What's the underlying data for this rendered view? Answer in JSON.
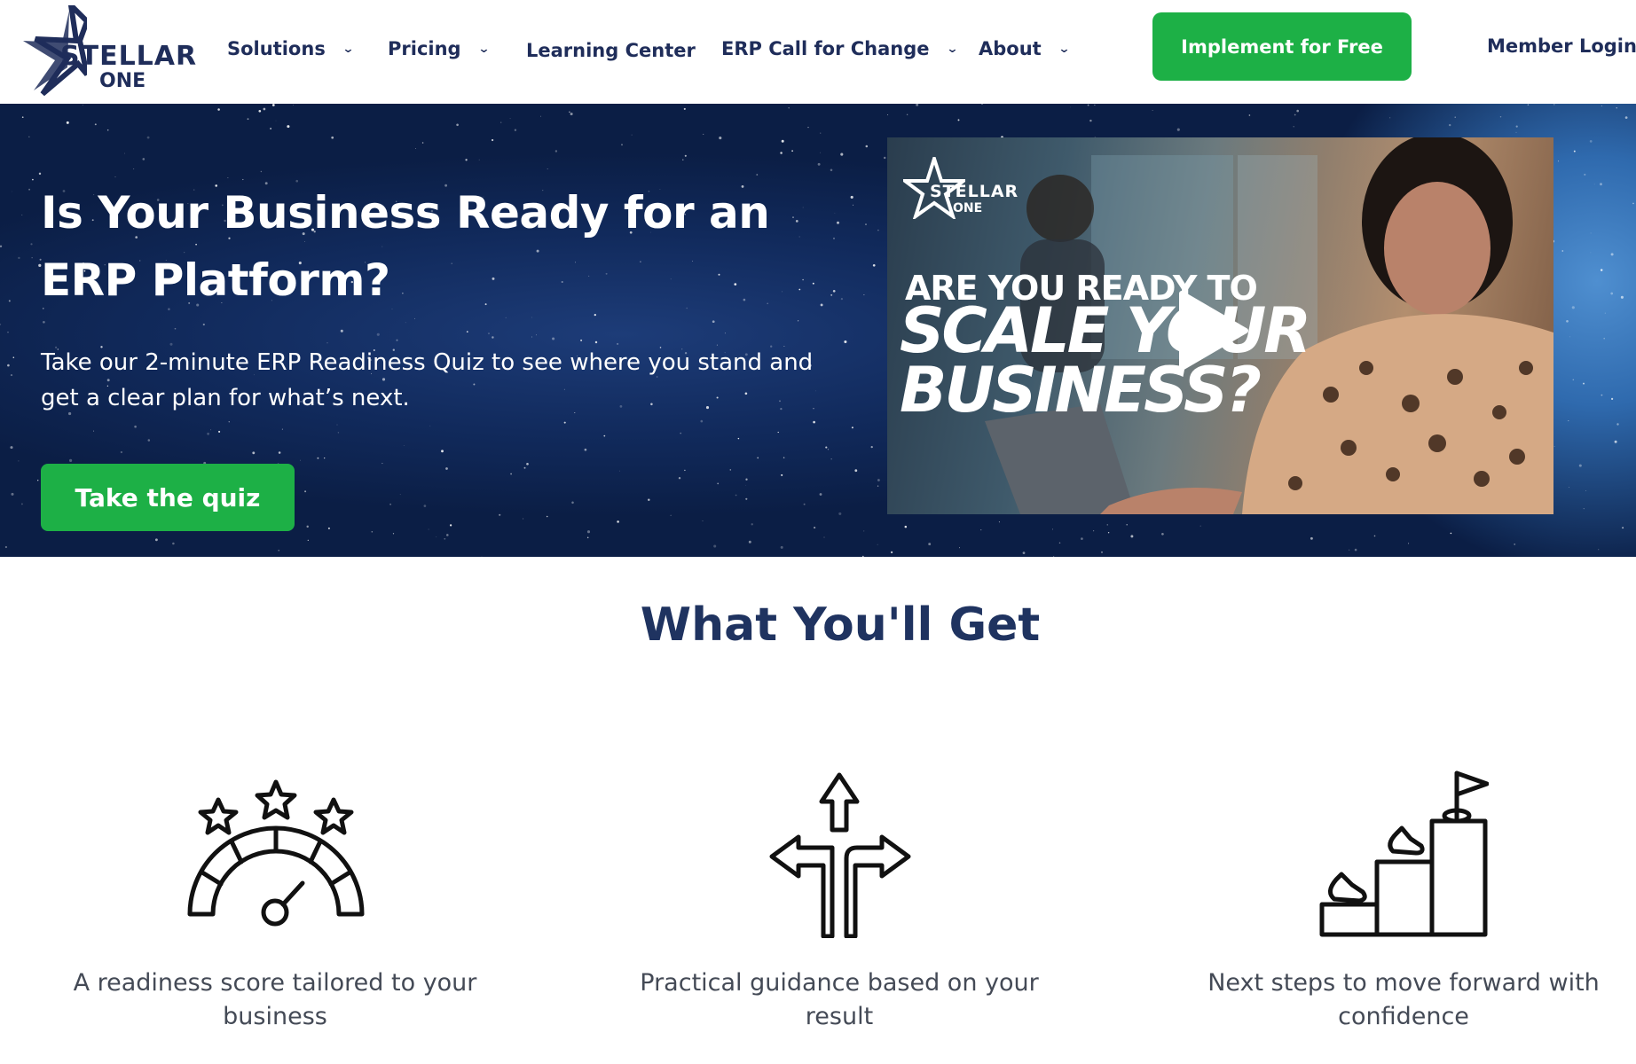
{
  "header": {
    "logo": {
      "top_text": "STELLAR",
      "bottom_text": "ONE",
      "icon": "star-logo-icon"
    },
    "nav": [
      {
        "label": "Solutions",
        "has_dropdown": true
      },
      {
        "label": "Pricing",
        "has_dropdown": true
      },
      {
        "label": "Learning Center",
        "has_dropdown": false
      },
      {
        "label": "ERP Call for Change",
        "has_dropdown": true
      },
      {
        "label": "About",
        "has_dropdown": true
      }
    ],
    "cta_label": "Implement for Free",
    "login_label": "Member Login"
  },
  "hero": {
    "title": "Is Your Business Ready for an ERP Platform?",
    "subtitle": "Take our 2-minute ERP Readiness Quiz to see where you stand and get a clear plan for what’s next.",
    "button_label": "Take the quiz",
    "video": {
      "logo_top": "STELLAR",
      "logo_bottom": "ONE",
      "line1": "ARE YOU READY TO",
      "line2": "SCALE YOUR",
      "line3": "BUSINESS?",
      "play_icon": "play-icon"
    }
  },
  "features": {
    "title": "What You'll Get",
    "items": [
      {
        "icon": "speedometer-stars-icon",
        "text": "A readiness score tailored to your business"
      },
      {
        "icon": "direction-arrows-icon",
        "text": "Practical guidance based on your result"
      },
      {
        "icon": "stairs-flag-icon",
        "text": "Next steps to move forward with confidence"
      }
    ]
  },
  "colors": {
    "brand_navy": "#1f2d5a",
    "cta_green": "#1db046",
    "hero_bg": "#0b1e45",
    "body_text": "#444a56"
  }
}
